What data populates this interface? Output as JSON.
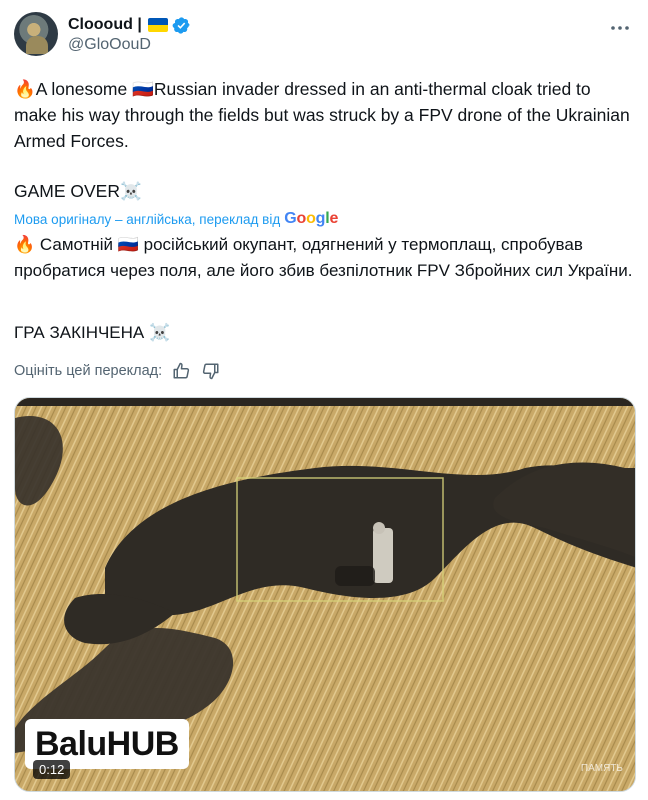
{
  "author": {
    "display_name": "Cloooud |",
    "handle": "@GloOouD",
    "avatar_icon": "avatar-soldier",
    "flag_colors": [
      "#0057b7",
      "#ffd700"
    ],
    "verified_color": "#1d9bf0"
  },
  "tweet": {
    "original_text": "🔥A lonesome 🇷🇺Russian invader dressed in an anti-thermal cloak tried to make his way through the fields but was struck by a FPV drone of the Ukrainian Armed Forces.",
    "game_over": "GAME OVER☠️",
    "translation_note": "Мова оригіналу – англійська, переклад від",
    "translation_provider": "Google",
    "translated_text": "🔥 Самотній 🇷🇺 російський окупант, одягнений у термоплащ, спробував пробратися через поля, але його збив безпілотник FPV Збройних сил України.",
    "game_over_translated": "ГРА ЗАКІНЧЕНА ☠️",
    "rate_prompt": "Оцініть цей переклад:"
  },
  "media": {
    "watermark": "BaluHUB",
    "duration": "0:12",
    "corner_tag": "ПАМЯТЬ"
  }
}
